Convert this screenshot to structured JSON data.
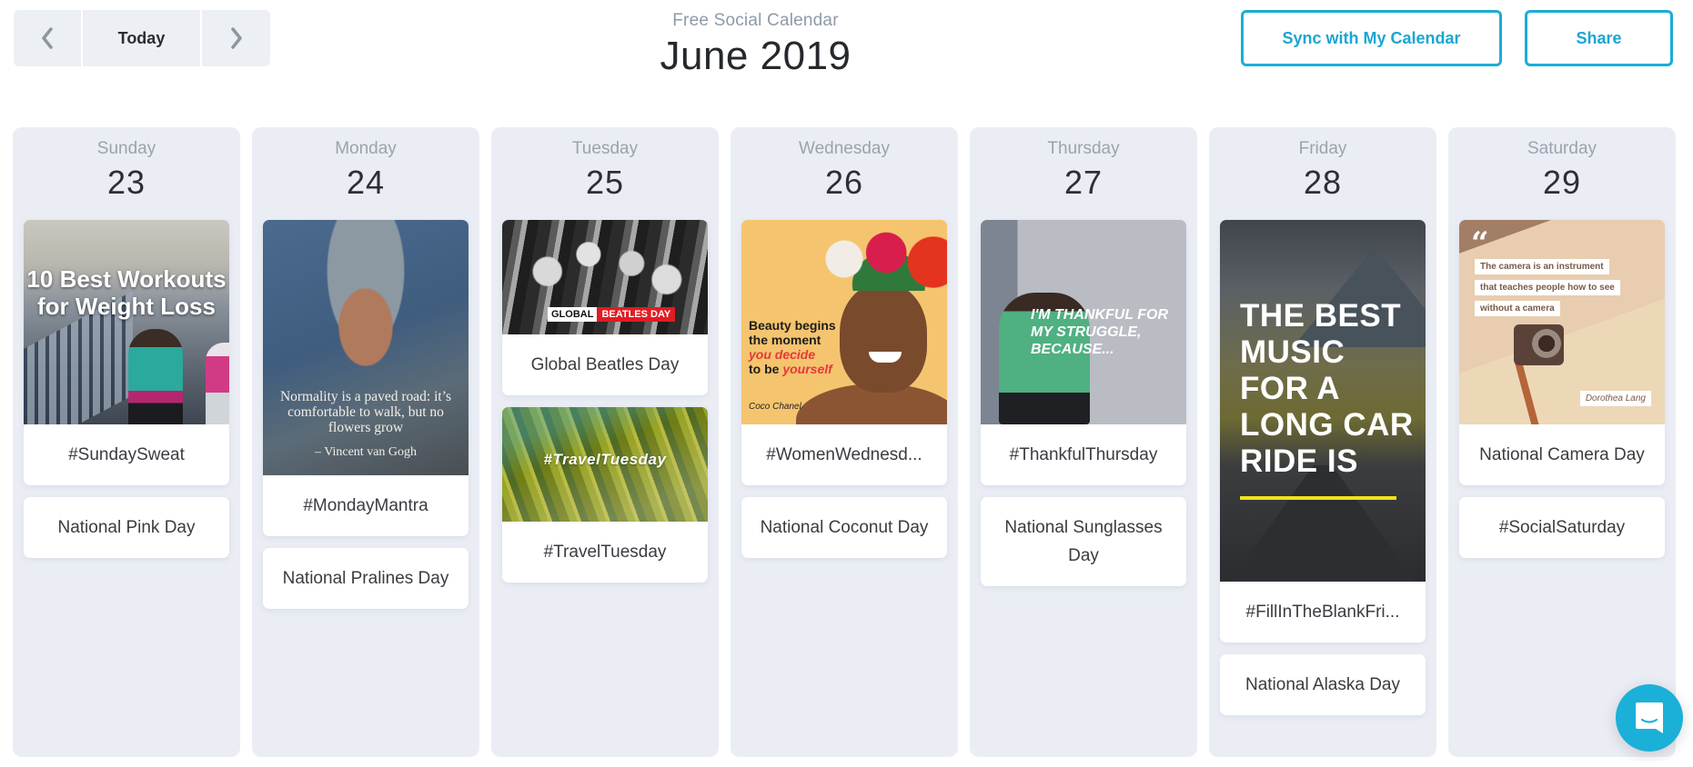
{
  "header": {
    "prev_icon": "chevron-left-icon",
    "today_label": "Today",
    "next_icon": "chevron-right-icon",
    "subtitle": "Free Social Calendar",
    "month_title": "June 2019",
    "sync_label": "Sync with My Calendar",
    "share_label": "Share"
  },
  "colors": {
    "accent": "#1badd6",
    "column_bg": "#eaedf4",
    "nav_bg": "#eceff3"
  },
  "days": [
    {
      "name": "Sunday",
      "date": "23",
      "cards": [
        {
          "label": "#SundaySweat",
          "image_text": "10 Best Workouts for Weight Loss"
        },
        {
          "label": "National Pink Day"
        }
      ]
    },
    {
      "name": "Monday",
      "date": "24",
      "cards": [
        {
          "label": "#MondayMantra",
          "image_text": "Normality is a paved road: it’s comfortable to walk, but no flowers grow",
          "image_author": "– Vincent van Gogh"
        },
        {
          "label": "National Pralines Day"
        }
      ]
    },
    {
      "name": "Tuesday",
      "date": "25",
      "cards": [
        {
          "label": "Global Beatles Day",
          "image_badge_1": "GLOBAL",
          "image_badge_2": "BEATLES DAY"
        },
        {
          "label": "#TravelTuesday",
          "image_text": "#TravelTuesday"
        }
      ]
    },
    {
      "name": "Wednesday",
      "date": "26",
      "cards": [
        {
          "label": "#WomenWednesd...",
          "image_lines": [
            "Beauty begins",
            "the moment",
            "you decide",
            "to be",
            "yourself"
          ],
          "image_author": "Coco Chanel"
        },
        {
          "label": "National Coconut Day"
        }
      ]
    },
    {
      "name": "Thursday",
      "date": "27",
      "cards": [
        {
          "label": "#ThankfulThursday",
          "image_text": "I'M THANKFUL FOR MY STRUGGLE, BECAUSE..."
        },
        {
          "label": "National Sunglasses Day"
        }
      ]
    },
    {
      "name": "Friday",
      "date": "28",
      "cards": [
        {
          "label": "#FillInTheBlankFri...",
          "image_text": "THE BEST MUSIC FOR A LONG CAR RIDE IS"
        },
        {
          "label": "National Alaska Day"
        }
      ]
    },
    {
      "name": "Saturday",
      "date": "29",
      "cards": [
        {
          "label": "National Camera Day",
          "image_lines": [
            "The camera is an instrument",
            "that teaches people how to see",
            "without a camera"
          ],
          "image_author": "Dorothea Lang"
        },
        {
          "label": "#SocialSaturday"
        }
      ]
    }
  ],
  "chat": {
    "icon": "chat-bubble-icon"
  }
}
